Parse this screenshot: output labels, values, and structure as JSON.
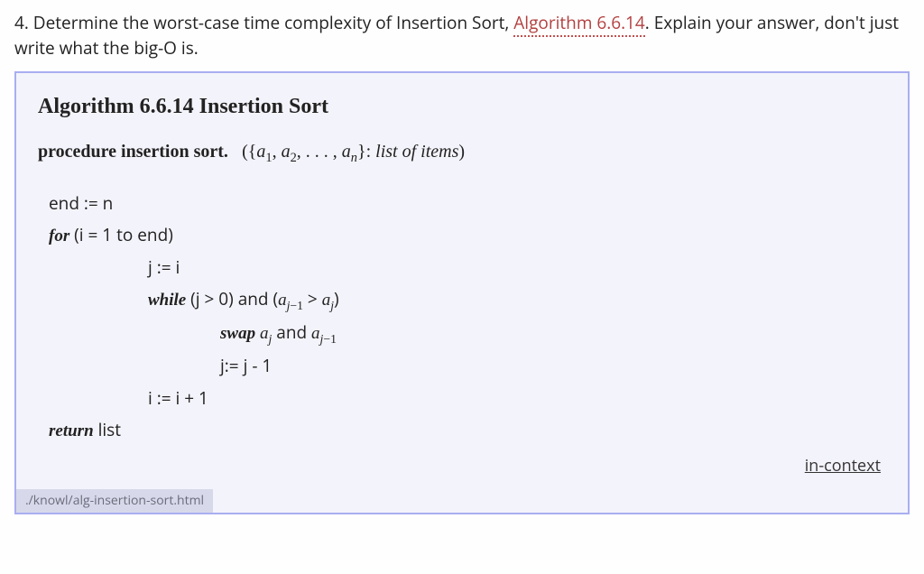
{
  "question": {
    "number": "4.",
    "text_before_link": " Determine the worst-case time complexity of Insertion Sort, ",
    "link_text": "Algorithm 6.6.14",
    "text_after_link": ". Explain your answer, don't just write what the big-O is."
  },
  "algorithm": {
    "title": "Algorithm 6.6.14  Insertion Sort",
    "procedure_label": "procedure insertion sort.",
    "procedure_desc": "list of items",
    "lines": {
      "l1": "end := n",
      "l2_kw": "for",
      "l2_rest": " (i = 1 to end)",
      "l3": "j := i",
      "l4_kw": "while",
      "l4_rest_a": " (j > 0) and (",
      "l4_rest_b": ")",
      "l5_kw": "swap",
      "l5_mid": " and ",
      "l6": "j:= j - 1",
      "l7": "i := i + 1",
      "l8_kw": "return",
      "l8_rest": " list"
    },
    "in_context": "in-context",
    "path": "./knowl/alg-insertion-sort.html"
  }
}
